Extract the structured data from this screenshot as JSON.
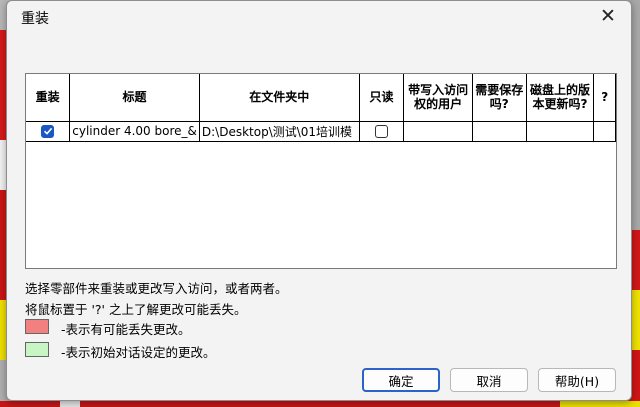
{
  "window": {
    "title": "重装",
    "close_glyph": "✕"
  },
  "table": {
    "headers": [
      "重装",
      "标题",
      "在文件夹中",
      "只读",
      "带写入访问权的用户",
      "需要保存吗?",
      "磁盘上的版本更新吗?",
      "?"
    ],
    "rows": [
      {
        "reload": true,
        "title": "cylinder 4.00 bore_&",
        "folder": "D:\\Desktop\\测试\\01培训模",
        "readonly": false,
        "users": "",
        "need_save": "",
        "newer_on_disk": "",
        "extra": ""
      }
    ]
  },
  "info": {
    "line1": "选择零部件来重装或更改写入访问，或者两者。",
    "line2": "将鼠标置于 '?' 之上了解更改可能丢失。"
  },
  "legend": [
    {
      "color": "#f28080",
      "text": "-表示有可能丢失更改。"
    },
    {
      "color": "#c8f5c4",
      "text": "-表示初始对话设定的更改。"
    }
  ],
  "buttons": {
    "ok": "确定",
    "cancel": "取消",
    "help": "帮助(H)"
  },
  "colors": {
    "accent": "#1a56c4"
  }
}
